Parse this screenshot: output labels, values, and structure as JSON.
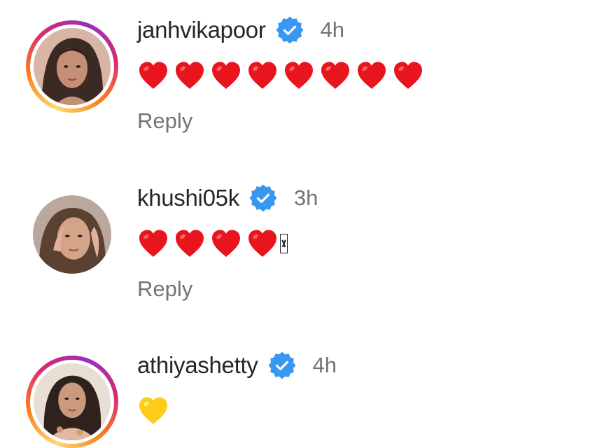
{
  "comments": [
    {
      "username": "janhvikapoor",
      "verified": true,
      "time": "4h",
      "text_icons": [
        "red-heart-emoji",
        "red-heart-emoji",
        "red-heart-emoji",
        "red-heart-emoji",
        "red-heart-emoji",
        "red-heart-emoji",
        "red-heart-emoji",
        "red-heart-emoji"
      ],
      "reply_label": "Reply",
      "has_story_ring": true
    },
    {
      "username": "khushi05k",
      "verified": true,
      "time": "3h",
      "text_icons": [
        "red-heart-emoji",
        "red-heart-emoji",
        "red-heart-emoji",
        "red-heart-emoji"
      ],
      "trailing_missing_glyph": true,
      "reply_label": "Reply",
      "has_story_ring": false
    },
    {
      "username": "athiyashetty",
      "verified": true,
      "time": "4h",
      "text_icons": [
        "yellow-heart-emoji"
      ],
      "has_story_ring": true
    }
  ],
  "colors": {
    "verified_badge": "#3897f0",
    "red_heart": "#e8141e",
    "yellow_heart": "#ffcc1a",
    "muted_text": "#737373",
    "primary_text": "#262626"
  }
}
